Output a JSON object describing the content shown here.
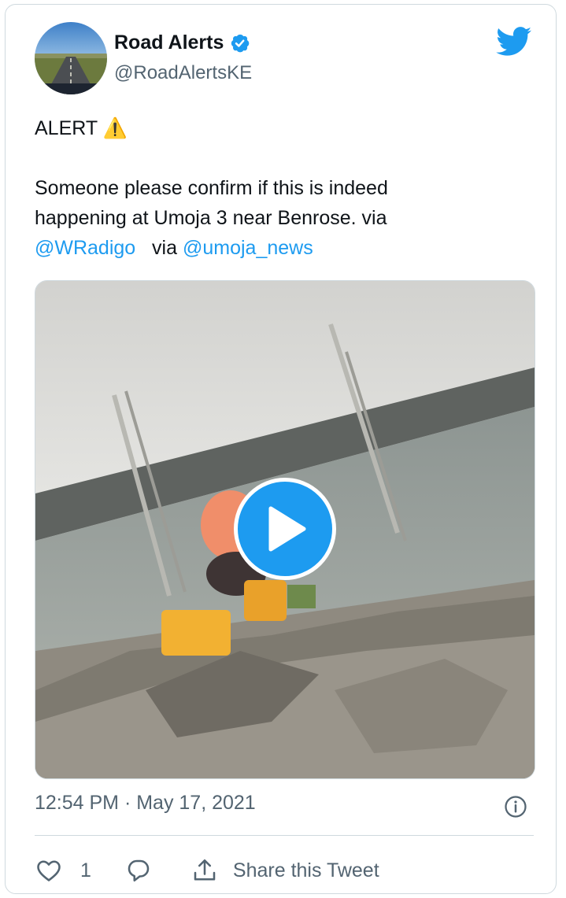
{
  "author": {
    "display_name": "Road Alerts",
    "handle": "@RoadAlertsKE",
    "verified": true
  },
  "tweet": {
    "line1": "ALERT ⚠️",
    "line2": "Someone please confirm if this is indeed",
    "line3": "happening at Umoja 3 near Benrose.  via",
    "mention1": "@WRadigo",
    "via_text": "via",
    "mention2": "@umoja_news"
  },
  "meta": {
    "timestamp": "12:54 PM · May 17, 2021"
  },
  "actions": {
    "like_count": "1",
    "share_label": "Share this Tweet"
  },
  "colors": {
    "accent": "#1d9bf0",
    "text": "#0f1419",
    "muted": "#536471",
    "border": "#cfd9de"
  },
  "icons": [
    "verified-badge-icon",
    "twitter-bird-icon",
    "play-icon",
    "info-icon",
    "heart-icon",
    "reply-icon",
    "share-icon"
  ]
}
